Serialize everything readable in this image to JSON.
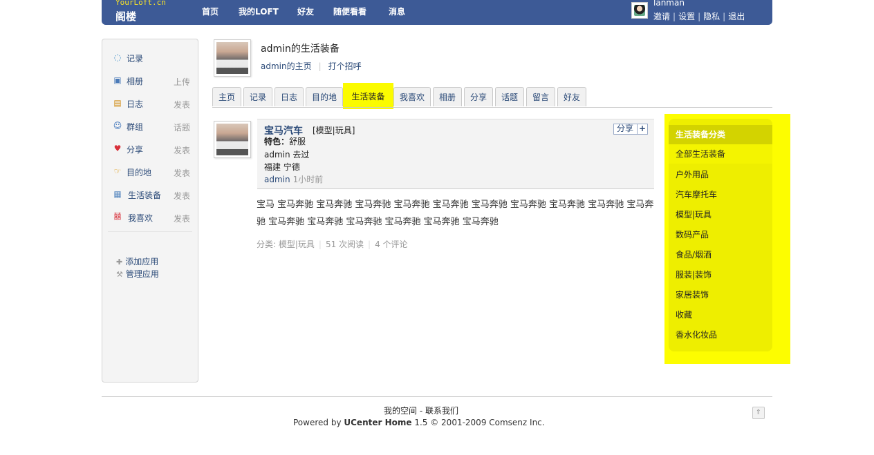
{
  "header": {
    "logo_small": "YourLoft.cn",
    "logo_big": "阁楼",
    "nav": [
      "首页",
      "我的LOFT",
      "好友",
      "随便看看",
      "消息"
    ],
    "username": "lanman",
    "user_links": [
      "邀请",
      "设置",
      "隐私",
      "退出"
    ],
    "link_separator": "|"
  },
  "sidebar": {
    "items": [
      {
        "icon": "speech-bubble-icon",
        "glyph": "💬",
        "label": "记录",
        "action": ""
      },
      {
        "icon": "photo-album-icon",
        "glyph": "🖼",
        "label": "相册",
        "action": "上传"
      },
      {
        "icon": "notebook-icon",
        "glyph": "📒",
        "label": "日志",
        "action": "发表"
      },
      {
        "icon": "group-icon",
        "glyph": "👥",
        "label": "群组",
        "action": "话题"
      },
      {
        "icon": "heart-icon",
        "glyph": "❤",
        "label": "分享",
        "action": "发表"
      },
      {
        "icon": "hand-icon",
        "glyph": "👉",
        "label": "目的地",
        "action": "发表"
      },
      {
        "icon": "gear-grid-icon",
        "glyph": "▦",
        "label": "生活装备",
        "action": "发表"
      },
      {
        "icon": "xi-icon",
        "glyph": "囍",
        "label": "我喜欢",
        "action": "发表"
      }
    ],
    "manage": [
      {
        "icon": "plus-icon",
        "glyph": "✚",
        "label": "添加应用"
      },
      {
        "icon": "wrench-icon",
        "glyph": "🔧",
        "label": "管理应用"
      }
    ]
  },
  "profile": {
    "title": "admin的生活装备",
    "home_link": "admin的主页",
    "greet_link": "打个招呼",
    "separator": "|"
  },
  "tabs": [
    {
      "label": "主页",
      "active": false
    },
    {
      "label": "记录",
      "active": false
    },
    {
      "label": "日志",
      "active": false
    },
    {
      "label": "目的地",
      "active": false
    },
    {
      "label": "生活装备",
      "active": true
    },
    {
      "label": "我喜欢",
      "active": false
    },
    {
      "label": "相册",
      "active": false
    },
    {
      "label": "分享",
      "active": false
    },
    {
      "label": "话题",
      "active": false
    },
    {
      "label": "留言",
      "active": false
    },
    {
      "label": "好友",
      "active": false
    }
  ],
  "post": {
    "title": "宝马汽车",
    "category": "[模型|玩具]",
    "share_label": "分享",
    "share_plus": "+",
    "feature_label": "特色：",
    "feature_value": "舒服",
    "line2": "admin 去过",
    "line3": "福建  宁德",
    "author": "admin",
    "time": "1小时前",
    "body": "宝马  宝马奔驰  宝马奔驰  宝马奔驰  宝马奔驰  宝马奔驰  宝马奔驰  宝马奔驰  宝马奔驰  宝马奔驰  宝马奔驰  宝马奔驰  宝马奔驰  宝马奔驰  宝马奔驰  宝马奔驰  宝马奔驰",
    "meta_category": "分类: 模型|玩具",
    "meta_reads": "51 次阅读",
    "meta_comments": "4 个评论",
    "meta_separator": "|"
  },
  "right_panel": {
    "title": "生活装备分类",
    "current": "全部生活装备",
    "items": [
      "户外用品",
      "汽车摩托车",
      "模型|玩具",
      "数码产品",
      "食品/烟酒",
      "服装|装饰",
      "家居装饰",
      "收藏",
      "香水化妆品"
    ]
  },
  "footer": {
    "links": "我的空间  - 联系我们",
    "powered_prefix": "Powered by ",
    "powered_brand": "UCenter Home",
    "powered_suffix": " 1.5 © 2001-2009 Comsenz Inc.",
    "top_glyph": "⇑"
  },
  "colors": {
    "header_bg": "#3d5a96",
    "highlight": "#fbfb00",
    "link": "#2b4a78"
  }
}
